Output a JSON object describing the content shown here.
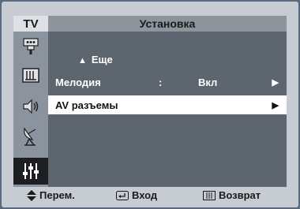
{
  "header": {
    "tv_label": "TV",
    "title": "Установка"
  },
  "sidebar": {
    "items": [
      {
        "icon": "input-icon"
      },
      {
        "icon": "picture-icon"
      },
      {
        "icon": "sound-icon"
      },
      {
        "icon": "channel-icon"
      },
      {
        "icon": "setup-icon",
        "active": true
      }
    ]
  },
  "menu": {
    "more_label": "Еще",
    "items": [
      {
        "label": "Мелодия",
        "separator": ":",
        "value": "Вкл",
        "arrow": "▶"
      },
      {
        "label": "AV разъемы",
        "arrow": "▶",
        "selected": true
      }
    ]
  },
  "footer": {
    "move": "Перем.",
    "enter": "Вход",
    "back": "Возврат"
  },
  "colors": {
    "selected_bg": "#ffffff",
    "panel_bg": "#5d656f",
    "sidebar_bg": "#8b939e",
    "active_icon_bg": "#1c1e22"
  }
}
